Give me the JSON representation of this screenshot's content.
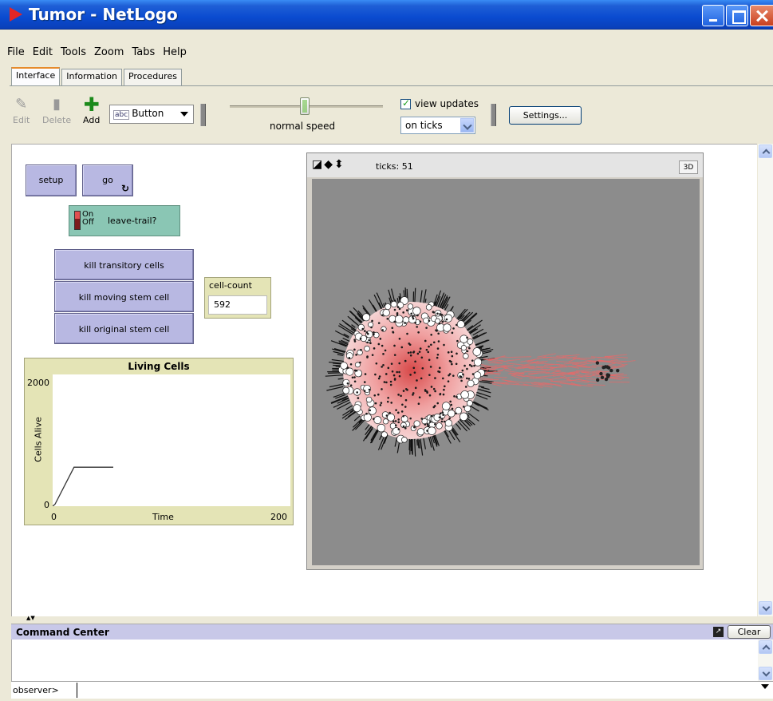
{
  "window": {
    "title": "Tumor - NetLogo"
  },
  "menu": [
    "File",
    "Edit",
    "Tools",
    "Zoom",
    "Tabs",
    "Help"
  ],
  "tabs": [
    "Interface",
    "Information",
    "Procedures"
  ],
  "toolbar": {
    "edit_label": "Edit",
    "delete_label": "Delete",
    "add_label": "Add",
    "widget_type_abc": "abc",
    "widget_type": "Button",
    "speed_label": "normal speed",
    "speed_fraction": 0.5,
    "view_updates_label": "view updates",
    "view_updates_checked": true,
    "update_mode": "on ticks",
    "settings_label": "Settings..."
  },
  "widgets": {
    "setup_label": "setup",
    "go_label": "go",
    "go_forever_icon": "loop-icon",
    "switch_on": "On",
    "switch_off": "Off",
    "switch_label": "leave-trail?",
    "kill_transitory": "kill transitory cells",
    "kill_moving": "kill moving stem cell",
    "kill_original": "kill original stem cell",
    "monitor_label": "cell-count",
    "monitor_value": "592"
  },
  "plot": {
    "title": "Living Cells",
    "ylabel": "Cells Alive",
    "xlabel": "Time",
    "ymax_label": "2000",
    "ymin_label": "0",
    "xmin_label": "0",
    "xmax_label": "200"
  },
  "chart_data": {
    "type": "line",
    "title": "Living Cells",
    "xlabel": "Time",
    "ylabel": "Cells Alive",
    "xlim": [
      0,
      200
    ],
    "ylim": [
      0,
      2000
    ],
    "series": [
      {
        "x": [
          0,
          2,
          18,
          51
        ],
        "y": [
          0,
          30,
          592,
          592
        ]
      }
    ]
  },
  "view": {
    "ticks_label": "ticks: 51",
    "threed_label": "3D",
    "background": "#8c8c8c"
  },
  "command_center": {
    "title": "Command Center",
    "clear_label": "Clear",
    "agent_label": "observer>"
  }
}
